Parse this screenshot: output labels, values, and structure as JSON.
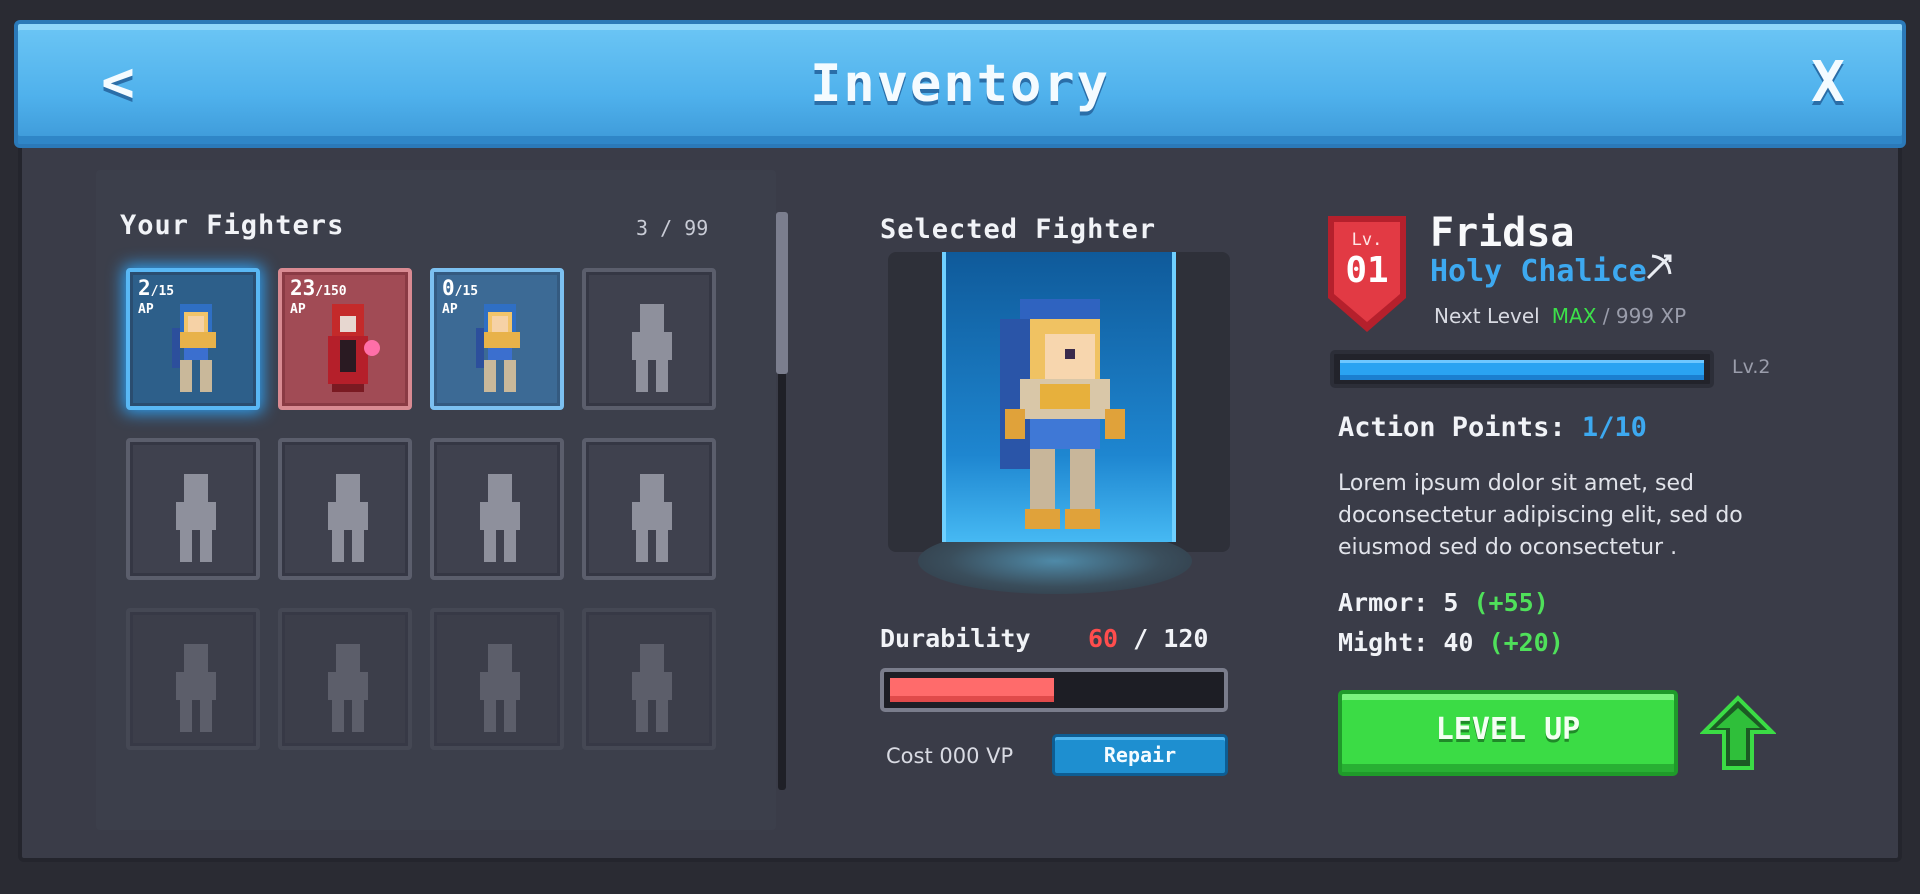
{
  "header": {
    "title": "Inventory",
    "back_glyph": "<",
    "close_glyph": "X"
  },
  "fighters_panel": {
    "title": "Your Fighters",
    "count": "3 / 99",
    "slots": [
      {
        "state": "selected",
        "ap_current": "2",
        "ap_max": "/15",
        "ap_label": "AP"
      },
      {
        "state": "owned-red",
        "ap_current": "23",
        "ap_max": "/150",
        "ap_label": "AP"
      },
      {
        "state": "owned-blue",
        "ap_current": "0",
        "ap_max": "/15",
        "ap_label": "AP"
      }
    ]
  },
  "selected_fighter": {
    "title": "Selected Fighter",
    "durability_label": "Durability",
    "durability_current": "60",
    "durability_max": "/ 120",
    "durability_fraction": 0.5,
    "cost_label": "Cost 000 VP",
    "repair_label": "Repair"
  },
  "fighter_info": {
    "level_prefix": "Lv.",
    "level": "01",
    "name": "Fridsa",
    "class": "Holy Chalice",
    "class_icon": "bow-icon",
    "next_level_label": "Next Level",
    "next_level_max": "MAX",
    "next_level_xp": "/ 999 XP",
    "xp_fraction": 1.0,
    "xp_bar_label": "Lv.2",
    "action_points_label": "Action Points:",
    "action_points_value": "1/10",
    "description": "Lorem ipsum dolor sit amet, sed doconsectetur adipiscing elit, sed do eiusmod sed do oconsectetur .",
    "armor_label": "Armor: 5",
    "armor_bonus": "(+55)",
    "might_label": "Might: 40",
    "might_bonus": "(+20)",
    "level_up_label": "LEVEL UP"
  },
  "colors": {
    "header_blue": "#4fb1ec",
    "accent_blue": "#3da9f0",
    "durability_red": "#ff4d4d",
    "bonus_green": "#4fe05a",
    "levelup_green": "#3bdc45"
  }
}
